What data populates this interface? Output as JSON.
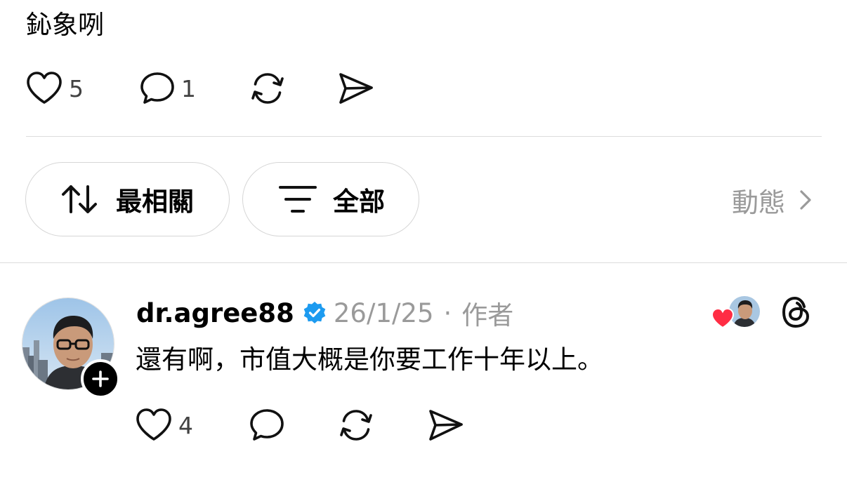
{
  "post": {
    "text": "鈊象咧",
    "like_count": "5",
    "reply_count": "1"
  },
  "filters": {
    "sort_label": "最相關",
    "filter_label": "全部",
    "activity_label": "動態"
  },
  "comment": {
    "username": "dr.agree88",
    "date": "26/1/25",
    "separator": "·",
    "author_tag": "作者",
    "text": "還有啊，市值大概是你要工作十年以上。",
    "like_count": "4"
  },
  "icons": {
    "like": "heart-icon",
    "reply": "speech-bubble-icon",
    "repost": "repost-icon",
    "share": "paper-plane-icon",
    "sort": "sort-arrows-icon",
    "filter": "filter-lines-icon",
    "chevron": "chevron-right-icon",
    "verified": "verified-badge-icon",
    "threads": "threads-logo-icon",
    "author_like": "red-heart-icon",
    "follow": "plus-icon"
  },
  "colors": {
    "verified_blue": "#1d9bf0",
    "author_heart_red": "#ff2d44",
    "muted_text": "#9a9a9a"
  }
}
